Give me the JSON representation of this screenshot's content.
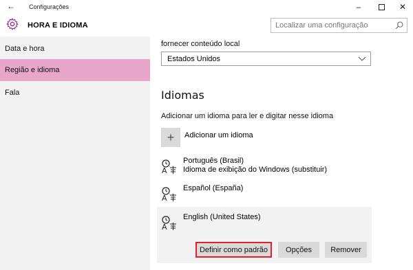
{
  "window": {
    "title": "Configurações",
    "back_glyph": "←",
    "minimize_glyph": "–",
    "close_glyph": "✕"
  },
  "header": {
    "title": "HORA E IDIOMA",
    "search_placeholder": "Localizar uma configuração"
  },
  "sidebar": {
    "items": [
      {
        "label": "Data e hora"
      },
      {
        "label": "Região e idioma"
      },
      {
        "label": "Fala"
      }
    ]
  },
  "main": {
    "cut_text": "fornecer conteúdo local",
    "country_select_value": "Estados Unidos",
    "languages_heading": "Idiomas",
    "languages_description": "Adicionar um idioma para ler e digitar nesse idioma",
    "add_plus": "+",
    "add_language_label": "Adicionar um idioma",
    "languages": [
      {
        "name": "Português (Brasil)",
        "subtitle": "Idioma de exibição do Windows (substituir)"
      },
      {
        "name": "Español (España)",
        "subtitle": ""
      },
      {
        "name": "English (United States)",
        "subtitle": ""
      }
    ],
    "buttons": {
      "set_default": "Definir como padrão",
      "options": "Opções",
      "remove": "Remover"
    }
  },
  "colors": {
    "accent": "#e9a6cb",
    "highlight_border": "#e0202f",
    "sidebar_bg": "#f2f2f2",
    "button_bg": "#d9d9d9"
  }
}
